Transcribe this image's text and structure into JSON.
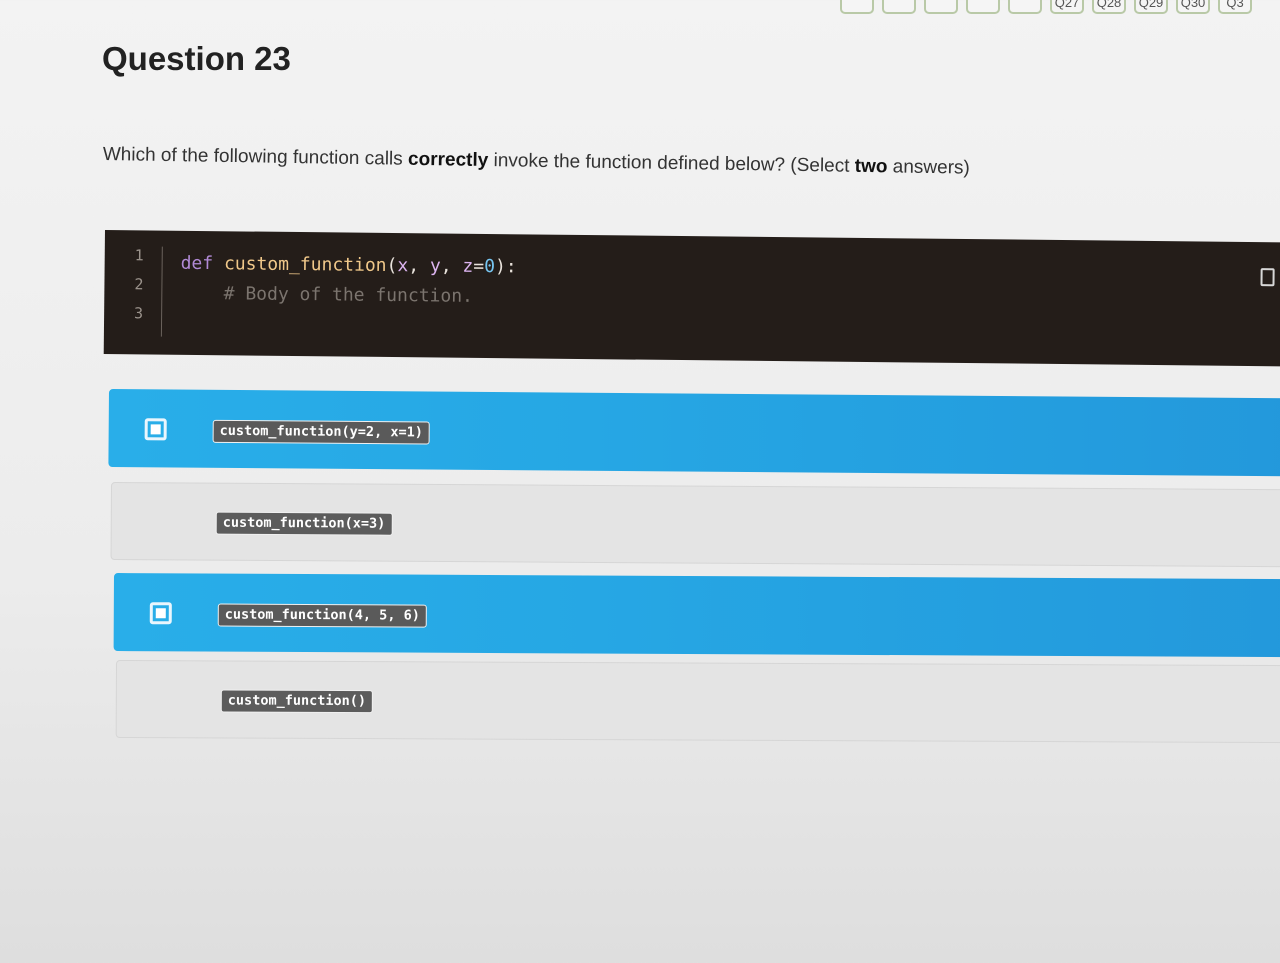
{
  "nav": {
    "items": [
      "Q27",
      "Q28",
      "Q29",
      "Q30",
      "Q3"
    ]
  },
  "question": {
    "title": "Question 23",
    "prompt_pre": "Which of the following function calls ",
    "prompt_bold1": "correctly",
    "prompt_mid": " invoke the function defined below? (Select ",
    "prompt_bold2": "two",
    "prompt_post": " answers)"
  },
  "code": {
    "line_numbers": [
      "1",
      "2",
      "3"
    ],
    "line1": {
      "kw": "def",
      "fn": "custom_function",
      "open": "(",
      "p1": "x",
      "c1": ", ",
      "p2": "y",
      "c2": ", ",
      "p3": "z",
      "eq": "=",
      "default": "0",
      "close": "):"
    },
    "line2": "# Body of the function."
  },
  "options": [
    {
      "label": "custom_function(y=2, x=1)",
      "selected": true
    },
    {
      "label": "custom_function(x=3)",
      "selected": false
    },
    {
      "label": "custom_function(4, 5, 6)",
      "selected": true
    },
    {
      "label": "custom_function()",
      "selected": false
    }
  ],
  "colors": {
    "selected": "#29aee9",
    "unselected": "#e4e4e4",
    "code_bg": "#241d19"
  }
}
